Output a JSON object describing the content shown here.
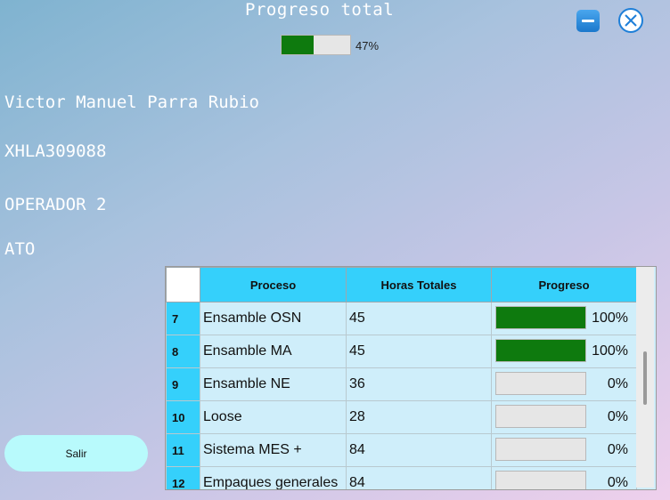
{
  "header": {
    "title": "Progreso total",
    "total_progress_percent": 47,
    "total_progress_label": "47%"
  },
  "window_controls": {
    "minimize_icon": "minimize-icon",
    "close_icon": "close-circle-icon"
  },
  "operator": {
    "name": "Victor Manuel Parra Rubio",
    "id": "XHLA309088",
    "role": "OPERADOR 2",
    "area": "ATO"
  },
  "exit_button": {
    "label": "Salir"
  },
  "table": {
    "columns": [
      "Proceso",
      "Horas Totales",
      "Progreso"
    ],
    "rows": [
      {
        "num": "7",
        "proceso": "Ensamble OSN",
        "horas": "45",
        "progreso": 100,
        "progreso_label": "100%"
      },
      {
        "num": "8",
        "proceso": "Ensamble MA",
        "horas": "45",
        "progreso": 100,
        "progreso_label": "100%"
      },
      {
        "num": "9",
        "proceso": "Ensamble NE",
        "horas": "36",
        "progreso": 0,
        "progreso_label": "0%"
      },
      {
        "num": "10",
        "proceso": "Loose",
        "horas": "28",
        "progreso": 0,
        "progreso_label": "0%"
      },
      {
        "num": "11",
        "proceso": "Sistema MES +",
        "horas": "84",
        "progreso": 0,
        "progreso_label": "0%"
      },
      {
        "num": "12",
        "proceso": "Empaques generales",
        "horas": "84",
        "progreso": 0,
        "progreso_label": "0%"
      }
    ]
  },
  "colors": {
    "progress_fill": "#0e7a0e",
    "header_cyan": "#35d0fb",
    "button_bg": "#b8fafc"
  }
}
